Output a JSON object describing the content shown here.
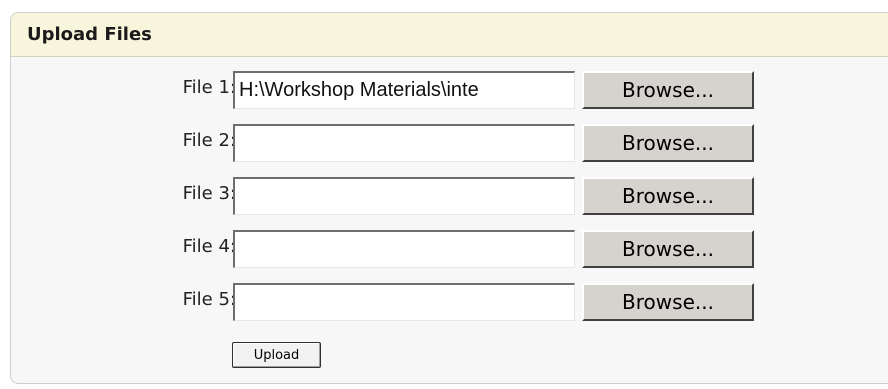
{
  "panel": {
    "title": "Upload Files"
  },
  "files": [
    {
      "label": "File 1:",
      "value": "H:\\Workshop Materials\\inte",
      "browse_label": "Browse..."
    },
    {
      "label": "File 2:",
      "value": "",
      "browse_label": "Browse..."
    },
    {
      "label": "File 3:",
      "value": "",
      "browse_label": "Browse..."
    },
    {
      "label": "File 4:",
      "value": "",
      "browse_label": "Browse..."
    },
    {
      "label": "File 5:",
      "value": "",
      "browse_label": "Browse..."
    }
  ],
  "upload_label": "Upload",
  "colors": {
    "header_bg": "#f7f5dc",
    "panel_bg": "#f7f7f7",
    "button_face": "#d6d3ce"
  }
}
